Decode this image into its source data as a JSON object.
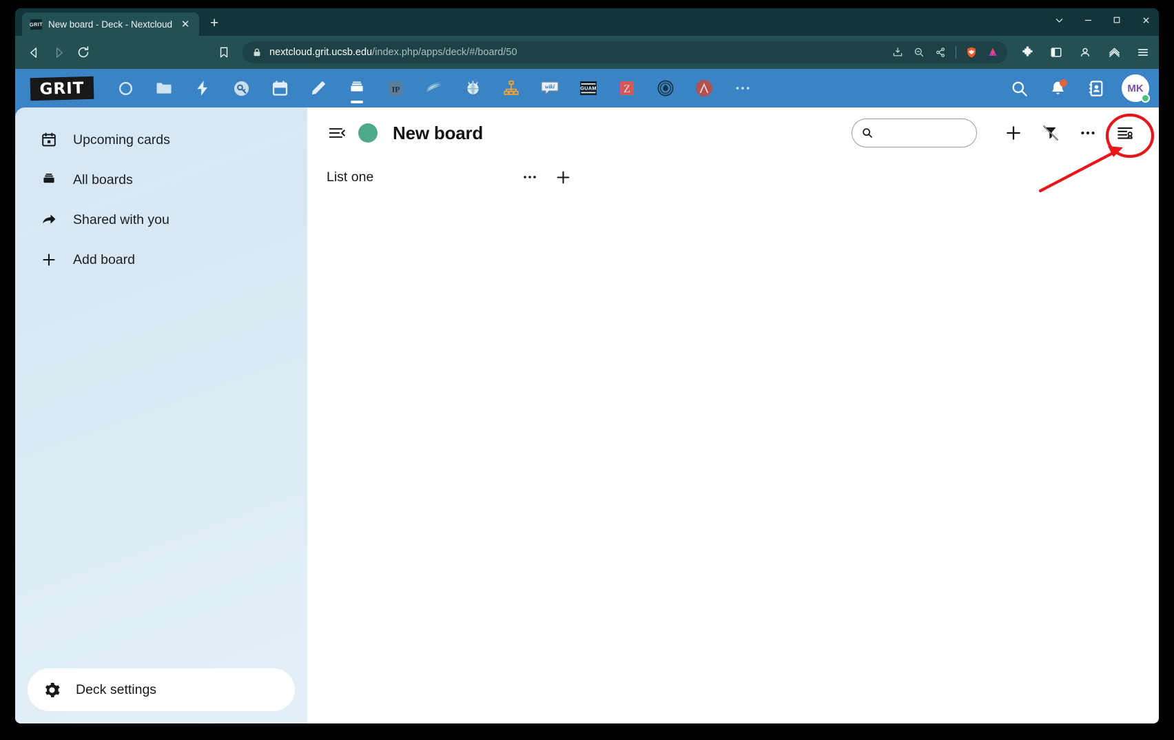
{
  "browser": {
    "tab": {
      "favicon_label": "GRIT",
      "title": "New board - Deck - Nextcloud",
      "close_label": "✕"
    },
    "new_tab_label": "+",
    "window_controls": {
      "more": "⌄",
      "minimize": "–",
      "maximize": "✕"
    },
    "nav": {
      "back": "◁",
      "forward": "▷",
      "reload": "⟳",
      "bookmark": "bookmark-icon"
    },
    "url": {
      "domain": "nextcloud.grit.ucsb.edu",
      "path": "/index.php/apps/deck/#/board/50",
      "full": "nextcloud.grit.ucsb.edu/index.php/apps/deck/#/board/50",
      "lock_icon": "lock-icon"
    },
    "url_right_icons": [
      "install-app-icon",
      "zoom-icon",
      "share-icon",
      "brave-shields-icon",
      "brave-rewards-icon"
    ],
    "extension_icons": [
      "extensions-puzzle-icon",
      "sidebar-panel-icon",
      "profile-icon",
      "brave-leo-icon",
      "browser-menu-icon"
    ]
  },
  "nextcloud": {
    "logo_text": "GRIT",
    "apps": [
      {
        "name": "dashboard-icon",
        "label": "Dashboard"
      },
      {
        "name": "files-icon",
        "label": "Files"
      },
      {
        "name": "activity-icon",
        "label": "Activity"
      },
      {
        "name": "passwords-icon",
        "label": "Passwords"
      },
      {
        "name": "calendar-icon",
        "label": "Calendar"
      },
      {
        "name": "notes-icon",
        "label": "Notes"
      },
      {
        "name": "deck-icon",
        "label": "Deck"
      },
      {
        "name": "ip-tool-icon",
        "label": "IP"
      },
      {
        "name": "stack-icon",
        "label": "Stack"
      },
      {
        "name": "globe-icon",
        "label": "Globe"
      },
      {
        "name": "org-chart-icon",
        "label": "Org chart"
      },
      {
        "name": "wiki-icon",
        "label": "wiki"
      },
      {
        "name": "guam-icon",
        "label": "GUAM"
      },
      {
        "name": "zotero-icon",
        "label": "Z"
      },
      {
        "name": "flame-icon",
        "label": "Flame"
      },
      {
        "name": "ansible-icon",
        "label": "A"
      },
      {
        "name": "more-apps-icon",
        "label": "⋯"
      }
    ],
    "active_app": "deck-icon",
    "right": {
      "search": "search-icon",
      "notifications": "bell-icon",
      "contacts": "contacts-icon",
      "avatar_initials": "MK",
      "status": "online"
    }
  },
  "sidebar": {
    "items": [
      {
        "label": "Upcoming cards",
        "icon": "calendar-upcoming-icon"
      },
      {
        "label": "All boards",
        "icon": "boards-icon"
      },
      {
        "label": "Shared with you",
        "icon": "share-arrow-icon"
      },
      {
        "label": "Add board",
        "icon": "plus-icon"
      }
    ],
    "settings": {
      "label": "Deck settings",
      "icon": "gear-icon"
    }
  },
  "board": {
    "title": "New board",
    "color": "#4fa98a",
    "collapse_icon": "collapse-sidebar-icon",
    "search": {
      "value": "",
      "placeholder": "",
      "icon": "search-icon"
    },
    "actions": [
      {
        "name": "add-card-button",
        "icon": "plus-icon",
        "label": "+"
      },
      {
        "name": "filter-button",
        "icon": "filter-off-icon",
        "label": ""
      },
      {
        "name": "board-menu-button",
        "icon": "ellipsis-icon",
        "label": "⋯"
      },
      {
        "name": "board-details-button",
        "icon": "details-sidebar-icon",
        "label": ""
      }
    ],
    "lists": [
      {
        "title": "List one",
        "menu_label": "⋯",
        "add_label": "+",
        "cards": []
      }
    ]
  },
  "annotation": {
    "highlight_color": "#e8161a",
    "target": "board-details-button",
    "shape": "circle-with-arrow"
  }
}
